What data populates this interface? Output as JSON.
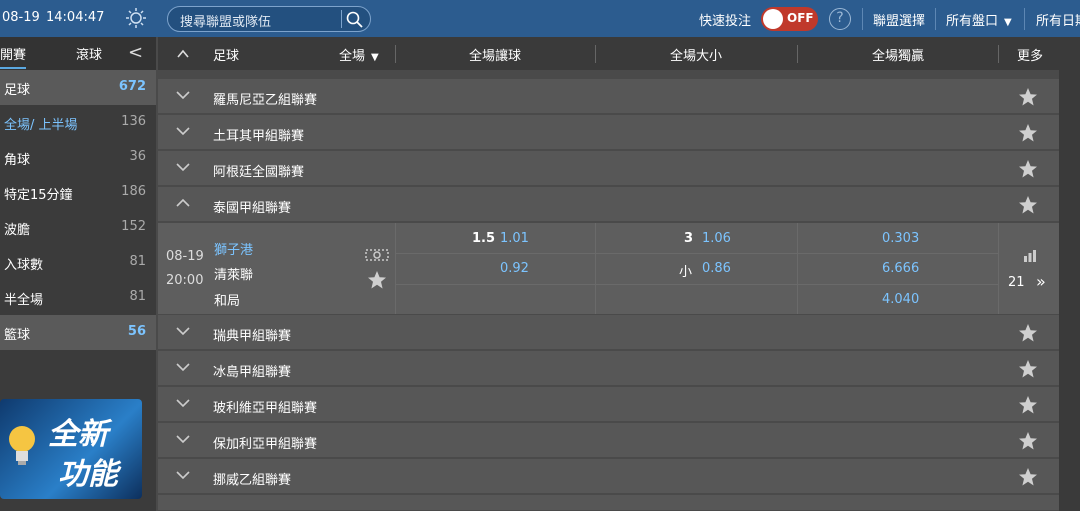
{
  "topbar": {
    "date": "08-19",
    "time": "14:04:47",
    "search_placeholder": "搜尋聯盟或隊伍",
    "quick_bet_label": "快速投注",
    "toggle_state": "OFF",
    "help": "?",
    "league_select": "聯盟選擇",
    "all_markets": "所有盤口",
    "all_dates": "所有日期"
  },
  "sidebar": {
    "tabs": [
      "開賽",
      "滾球"
    ],
    "items": [
      {
        "label": "足球",
        "count": "672"
      },
      {
        "label": "全場/ 上半場",
        "count": "136"
      },
      {
        "label": "角球",
        "count": "36"
      },
      {
        "label": "特定15分鐘",
        "count": "186"
      },
      {
        "label": "波膽",
        "count": "152"
      },
      {
        "label": "入球數",
        "count": "81"
      },
      {
        "label": "半全場",
        "count": "81"
      },
      {
        "label": "籃球",
        "count": "56"
      }
    ],
    "promo": {
      "line1": "全新",
      "line2": "功能"
    }
  },
  "header": {
    "sport": "足球",
    "period": "全場",
    "handicap": "全場讓球",
    "over_under": "全場大小",
    "one_x_two": "全場獨贏",
    "more": "更多"
  },
  "leagues": [
    "羅馬尼亞乙組聯賽",
    "土耳其甲組聯賽",
    "阿根廷全國聯賽",
    "泰國甲組聯賽",
    "瑞典甲組聯賽",
    "冰島甲組聯賽",
    "玻利維亞甲組聯賽",
    "保加利亞甲組聯賽",
    "挪威乙組聯賽"
  ],
  "match": {
    "date": "08-19",
    "time": "20:00",
    "home": "獅子港",
    "away": "清萊聯",
    "draw": "和局",
    "hdp_line": "1.5",
    "hdp_home": "1.01",
    "hdp_away": "0.92",
    "ou_line": "3",
    "ou_over": "1.06",
    "ou_under_label": "小",
    "ou_under": "0.86",
    "x_home": "0.303",
    "x_away": "6.666",
    "x_draw": "4.040",
    "more_count": "21",
    "more_arrow": "»"
  },
  "colors": {
    "accent": "#2c5c8f",
    "odds_blue": "#7cc4ff",
    "toggle_off": "#c0392b"
  }
}
